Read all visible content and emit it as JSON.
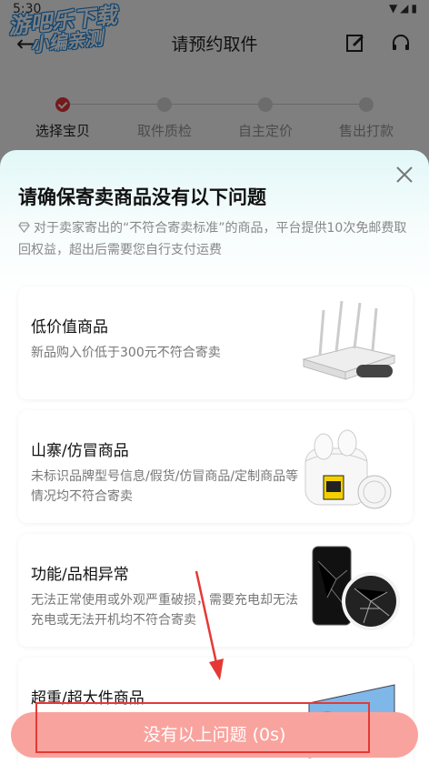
{
  "status_bar": {
    "time": "5:30"
  },
  "watermark": {
    "line1": "游吧乐下载",
    "line2": "小编亲测"
  },
  "header": {
    "title": "请预约取件"
  },
  "steps": [
    {
      "label": "选择宝贝",
      "active": true
    },
    {
      "label": "取件质检",
      "active": false
    },
    {
      "label": "自主定价",
      "active": false
    },
    {
      "label": "售出打款",
      "active": false
    }
  ],
  "sheet": {
    "title": "请确保寄卖商品没有以下问题",
    "notice": "对于卖家寄出的“不符合寄卖标准”的商品，平台提供10次免邮费取回权益，超出后需要您自行支付运费",
    "cards": [
      {
        "title": "低价值商品",
        "desc": "新品购入价低于300元不符合寄卖",
        "image_icon": "router-massager-image"
      },
      {
        "title": "山寨/仿冒商品",
        "desc": "未标识品牌型号信息/假货/仿冒商品/定制商品等情况均不符合寄卖",
        "image_icon": "earbuds-case-image"
      },
      {
        "title": "功能/品相异常",
        "desc": "无法正常使用或外观严重破损，需要充电却无法充电或无法开机均不符合寄卖",
        "image_icon": "cracked-phone-image"
      },
      {
        "title": "超重/超大件商品",
        "desc": "",
        "image_icon": "large-tv-image"
      }
    ]
  },
  "confirm_button": {
    "label": "没有以上问题 (0s)"
  },
  "colors": {
    "accent": "#e8353b",
    "button": "#f9a39e",
    "annotation": "#e53935"
  }
}
